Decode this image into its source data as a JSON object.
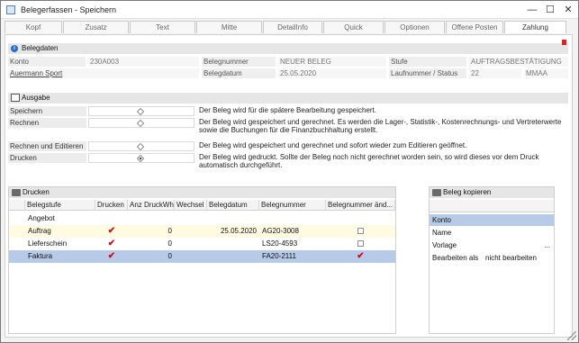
{
  "window": {
    "title": "Belegerfassen - Speichern",
    "minimize": "—",
    "maximize": "☐",
    "close": "✕"
  },
  "tabs": [
    "Kopf",
    "Zusatz",
    "Text",
    "Mitte",
    "DetailInfo",
    "Quick",
    "Optionen",
    "Offene Posten",
    "Zahlung"
  ],
  "belegdaten": {
    "header": "Belegdaten",
    "konto_label": "Konto",
    "konto_value": "230A003",
    "kunde_link": "Auermann Sport",
    "belegnummer_label": "Belegnummer",
    "belegnummer_value": "NEUER BELEG",
    "belegdatum_label": "Belegdatum",
    "belegdatum_value": "25.05.2020",
    "stufe_label": "Stufe",
    "stufe_value": "AUFTRAGSBESTÄTIGUNG",
    "laufnummer_label": "Laufnummer / Status",
    "laufnummer_value": "22",
    "status_value": "MMAA"
  },
  "ausgabe": {
    "header": "Ausgabe",
    "modes": [
      {
        "label": "Speichern",
        "selected": false,
        "desc_line1": "Der Beleg wird für die spätere Bearbeitung gespeichert.",
        "desc_line2": ""
      },
      {
        "label": "Rechnen",
        "selected": false,
        "desc_line1": "Der Beleg wird gespeichert und gerechnet. Es werden die Lager-, Statistik-, Kostenrechnungs- und Vertreterwerte",
        "desc_line2": "sowie die Buchungen für die Finanzbuchhaltung erstellt."
      },
      {
        "label": "Rechnen und Editieren",
        "selected": false,
        "desc_line1": "Der Beleg wird gespeichert und gerechnet und sofort wieder zum Editieren geöffnet.",
        "desc_line2": ""
      },
      {
        "label": "Drucken",
        "selected": true,
        "desc_line1": "Der Beleg wird gedruckt. Sollte der Beleg noch nicht gerechnet worden sein, so wird dieses vor dem Druck",
        "desc_line2": "automatisch durchgeführt."
      }
    ]
  },
  "drucken": {
    "header": "Drucken",
    "columns": [
      "Belegstufe",
      "Drucken",
      "Anz DruckWh.",
      "Wechsel",
      "Belegdatum",
      "Belegnummer",
      "Belegnummer änd..."
    ],
    "rows": [
      {
        "stufe": "Angebot",
        "drucken": false,
        "anz": "",
        "belegdatum": "",
        "belegnummer": "",
        "aendern": "none",
        "style": ""
      },
      {
        "stufe": "Auftrag",
        "drucken": true,
        "anz": "0",
        "belegdatum": "25.05.2020",
        "belegnummer": "AG20-3008",
        "aendern": "empty",
        "style": "yellow"
      },
      {
        "stufe": "Lieferschein",
        "drucken": true,
        "anz": "0",
        "belegdatum": "",
        "belegnummer": "LS20-4593",
        "aendern": "empty",
        "style": ""
      },
      {
        "stufe": "Faktura",
        "drucken": true,
        "anz": "0",
        "belegdatum": "",
        "belegnummer": "FA20-2111",
        "aendern": "checked",
        "style": "selected"
      }
    ],
    "check_glyph": "✔"
  },
  "beleg_kopieren": {
    "header": "Beleg kopieren",
    "rows": [
      {
        "label": "Konto",
        "value": ""
      },
      {
        "label": "Name",
        "value": ""
      },
      {
        "label": "Vorlage",
        "value": "..."
      },
      {
        "label": "Bearbeiten als",
        "value": "nicht bearbeiten"
      }
    ]
  }
}
